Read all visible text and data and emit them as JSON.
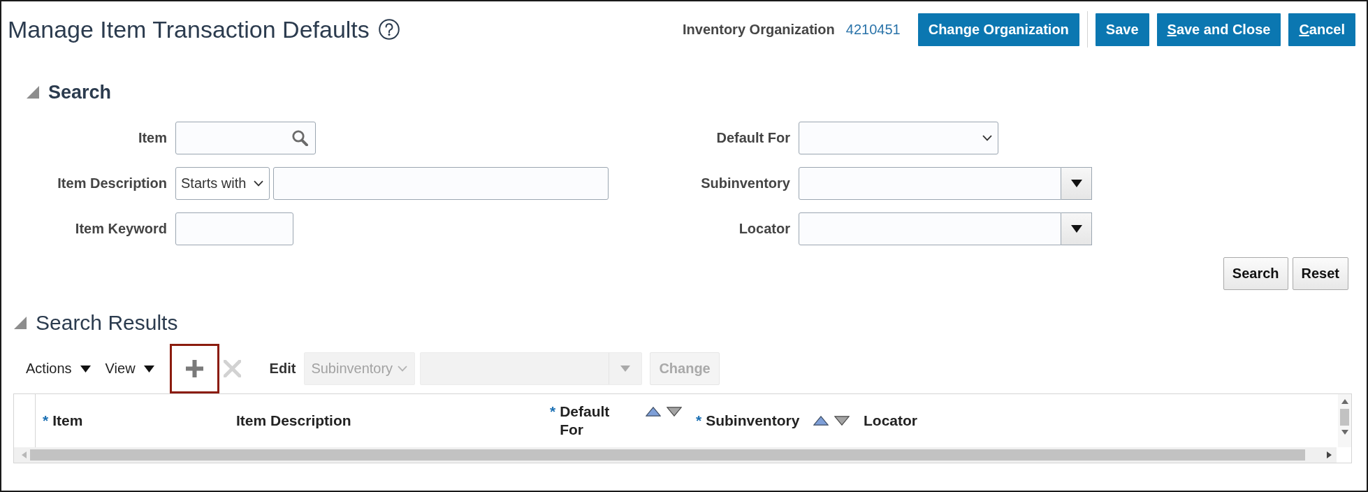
{
  "header": {
    "title": "Manage Item Transaction Defaults",
    "organization": {
      "label": "Inventory Organization",
      "value": "4210451"
    },
    "button_groups": [
      {
        "buttons": [
          {
            "label": "Change Organization",
            "mnemonic": false
          }
        ]
      },
      {
        "buttons": [
          {
            "label": "Save",
            "mnemonic": false
          },
          {
            "label": "Save and Close",
            "mnemonic": true
          },
          {
            "label": "Cancel",
            "mnemonic": true
          }
        ]
      }
    ]
  },
  "search": {
    "title": "Search",
    "expanded": true,
    "columns": [
      {
        "fields": [
          {
            "label": "Item",
            "kind": "lookup"
          },
          {
            "label": "Item Description",
            "kind": "operator_text",
            "operator": "Starts with"
          },
          {
            "label": "Item Keyword",
            "kind": "text"
          }
        ]
      },
      {
        "fields": [
          {
            "label": "Default For",
            "kind": "select"
          },
          {
            "label": "Subinventory",
            "kind": "combo"
          },
          {
            "label": "Locator",
            "kind": "combo"
          }
        ]
      }
    ],
    "buttons": [
      {
        "label": "Search"
      },
      {
        "label": "Reset"
      }
    ]
  },
  "results": {
    "title": "Search Results",
    "expanded": true,
    "menus": [
      {
        "label": "Actions"
      },
      {
        "label": "View"
      }
    ],
    "tools": [
      {
        "kind": "add",
        "disabled": false,
        "highlighted": true
      },
      {
        "kind": "delete",
        "disabled": true,
        "highlighted": false
      }
    ],
    "edit": {
      "label": "Edit",
      "attribute": {
        "value": "Subinventory",
        "disabled": true
      },
      "value_field": {
        "disabled": true
      },
      "apply": {
        "label": "Change",
        "disabled": true
      }
    },
    "table": {
      "columns": [
        {
          "label": "Item",
          "required_mark": "*",
          "sortable": false
        },
        {
          "label": "Item Description",
          "sortable": false
        },
        {
          "label": "Default For",
          "required_mark": "*",
          "sortable": true
        },
        {
          "label": "Subinventory",
          "required_mark": "*",
          "sortable": true
        },
        {
          "label": "Locator",
          "sortable": false
        }
      ]
    }
  }
}
